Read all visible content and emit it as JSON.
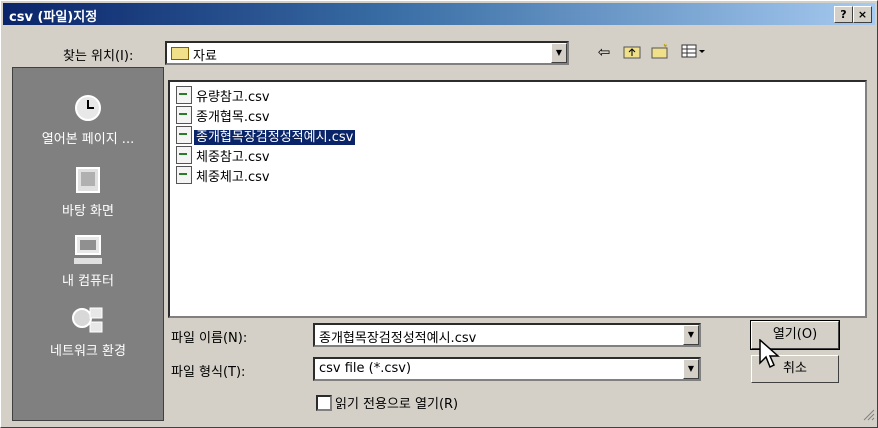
{
  "window": {
    "title": "csv (파일)지정",
    "help_label": "?",
    "close_label": "×"
  },
  "look_in": {
    "label": "찾는 위치(I):",
    "value": "자료"
  },
  "toolbar_icons": [
    "back-icon",
    "up-folder-icon",
    "new-folder-icon",
    "view-menu-icon"
  ],
  "places": [
    {
      "label": "열어본 페이지 ...",
      "icon": "history-icon"
    },
    {
      "label": "바탕 화면",
      "icon": "desktop-icon"
    },
    {
      "label": "내 컴퓨터",
      "icon": "my-computer-icon"
    },
    {
      "label": "네트워크 환경",
      "icon": "network-icon"
    }
  ],
  "files": [
    {
      "name": "유량참고.csv",
      "selected": false
    },
    {
      "name": "종개협목.csv",
      "selected": false
    },
    {
      "name": "종개협목장검정성적예시.csv",
      "selected": true
    },
    {
      "name": "체중참고.csv",
      "selected": false
    },
    {
      "name": "체중체고.csv",
      "selected": false
    }
  ],
  "filename": {
    "label": "파일 이름(N):",
    "value": "종개협목장검정성적예시.csv"
  },
  "filetype": {
    "label": "파일 형식(T):",
    "value": "csv file (*.csv)"
  },
  "readonly": {
    "label": "읽기 전용으로 열기(R)"
  },
  "buttons": {
    "open": "열기(O)",
    "cancel": "취소"
  }
}
